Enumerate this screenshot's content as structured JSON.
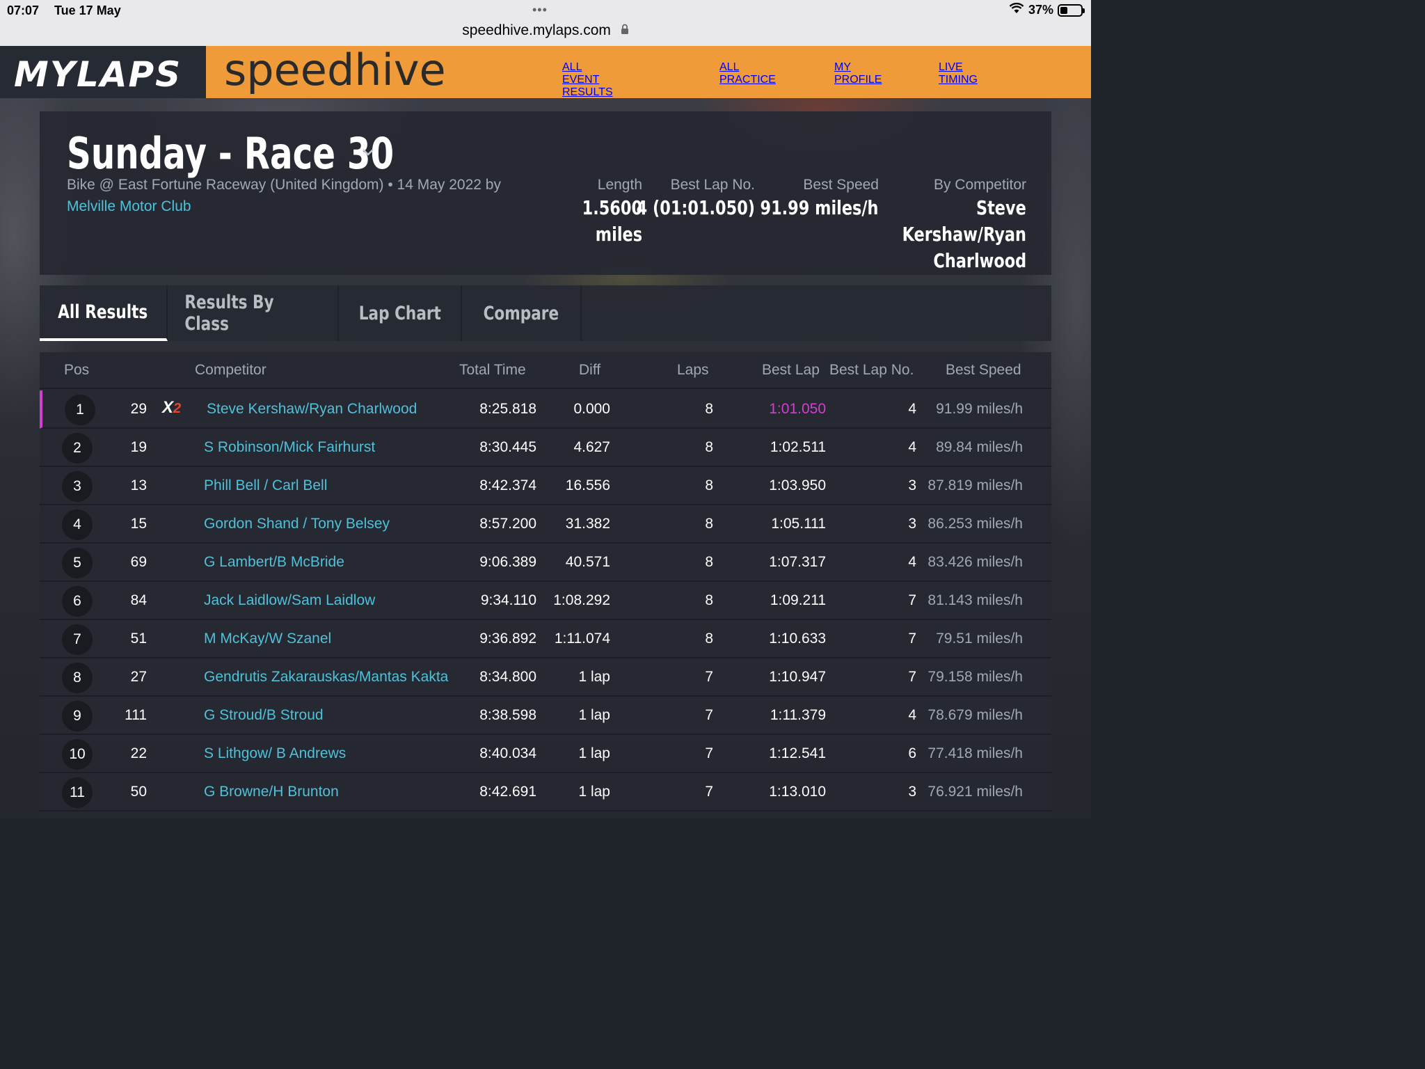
{
  "status_bar": {
    "time": "07:07",
    "date": "Tue 17 May",
    "url": "speedhive.mylaps.com",
    "battery": "37%",
    "battery_level": 0.37
  },
  "header": {
    "logo": "MYLAPS",
    "brand": "speedhive",
    "nav": [
      "ALL EVENT RESULTS",
      "ALL PRACTICE",
      "MY PROFILE",
      "LIVE TIMING"
    ],
    "active_nav": "ALL EVENT RESULTS",
    "colors": {
      "orange": "#ef9b39",
      "dark": "#252a33"
    }
  },
  "event": {
    "title": "Sunday - Race 30",
    "subtitle": "Bike @ East Fortune Raceway (United Kingdom) • 14 May 2022 by",
    "club": "Melville Motor Club",
    "stats": {
      "length_label": "Length",
      "length_value_1": "1.5600",
      "length_value_2": "miles",
      "best_lap_no_label": "Best Lap No.",
      "best_lap_no_value": "4 (01:01.050)",
      "best_speed_label": "Best Speed",
      "best_speed_value": "91.99 miles/h",
      "by_competitor_label": "By Competitor",
      "by_competitor_line1": "Steve",
      "by_competitor_line2": "Kershaw/Ryan",
      "by_competitor_line3": "Charlwood"
    }
  },
  "tabs": [
    "All Results",
    "Results By Class",
    "Lap Chart",
    "Compare"
  ],
  "active_tab": "All Results",
  "table": {
    "headers": {
      "pos": "Pos",
      "competitor": "Competitor",
      "total_time": "Total Time",
      "diff": "Diff",
      "laps": "Laps",
      "best_lap": "Best Lap",
      "best_lap_no": "Best Lap No.",
      "best_speed": "Best Speed"
    },
    "badge": {
      "x": "X",
      "n": "2"
    },
    "rows": [
      {
        "pos": "1",
        "num": "29",
        "name": "Steve Kershaw/Ryan Charlwood",
        "total": "8:25.818",
        "diff": "0.000",
        "laps": "8",
        "best_lap": "1:01.050",
        "best_lap_no": "4",
        "speed": "91.99 miles/h"
      },
      {
        "pos": "2",
        "num": "19",
        "name": "S Robinson/Mick Fairhurst",
        "total": "8:30.445",
        "diff": "4.627",
        "laps": "8",
        "best_lap": "1:02.511",
        "best_lap_no": "4",
        "speed": "89.84 miles/h"
      },
      {
        "pos": "3",
        "num": "13",
        "name": "Phill Bell / Carl Bell",
        "total": "8:42.374",
        "diff": "16.556",
        "laps": "8",
        "best_lap": "1:03.950",
        "best_lap_no": "3",
        "speed": "87.819 miles/h"
      },
      {
        "pos": "4",
        "num": "15",
        "name": "Gordon Shand / Tony Belsey",
        "total": "8:57.200",
        "diff": "31.382",
        "laps": "8",
        "best_lap": "1:05.111",
        "best_lap_no": "3",
        "speed": "86.253 miles/h"
      },
      {
        "pos": "5",
        "num": "69",
        "name": "G Lambert/B McBride",
        "total": "9:06.389",
        "diff": "40.571",
        "laps": "8",
        "best_lap": "1:07.317",
        "best_lap_no": "4",
        "speed": "83.426 miles/h"
      },
      {
        "pos": "6",
        "num": "84",
        "name": "Jack Laidlow/Sam Laidlow",
        "total": "9:34.110",
        "diff": "1:08.292",
        "laps": "8",
        "best_lap": "1:09.211",
        "best_lap_no": "7",
        "speed": "81.143 miles/h"
      },
      {
        "pos": "7",
        "num": "51",
        "name": "M McKay/W Szanel",
        "total": "9:36.892",
        "diff": "1:11.074",
        "laps": "8",
        "best_lap": "1:10.633",
        "best_lap_no": "7",
        "speed": "79.51 miles/h"
      },
      {
        "pos": "8",
        "num": "27",
        "name": "Gendrutis Zakarauskas/Mantas Kakta",
        "total": "8:34.800",
        "diff": "1 lap",
        "laps": "7",
        "best_lap": "1:10.947",
        "best_lap_no": "7",
        "speed": "79.158 miles/h"
      },
      {
        "pos": "9",
        "num": "111",
        "name": "G Stroud/B Stroud",
        "total": "8:38.598",
        "diff": "1 lap",
        "laps": "7",
        "best_lap": "1:11.379",
        "best_lap_no": "4",
        "speed": "78.679 miles/h"
      },
      {
        "pos": "10",
        "num": "22",
        "name": "S Lithgow/ B Andrews",
        "total": "8:40.034",
        "diff": "1 lap",
        "laps": "7",
        "best_lap": "1:12.541",
        "best_lap_no": "6",
        "speed": "77.418 miles/h"
      },
      {
        "pos": "11",
        "num": "50",
        "name": "G Browne/H Brunton",
        "total": "8:42.691",
        "diff": "1 lap",
        "laps": "7",
        "best_lap": "1:13.010",
        "best_lap_no": "3",
        "speed": "76.921 miles/h"
      }
    ]
  }
}
